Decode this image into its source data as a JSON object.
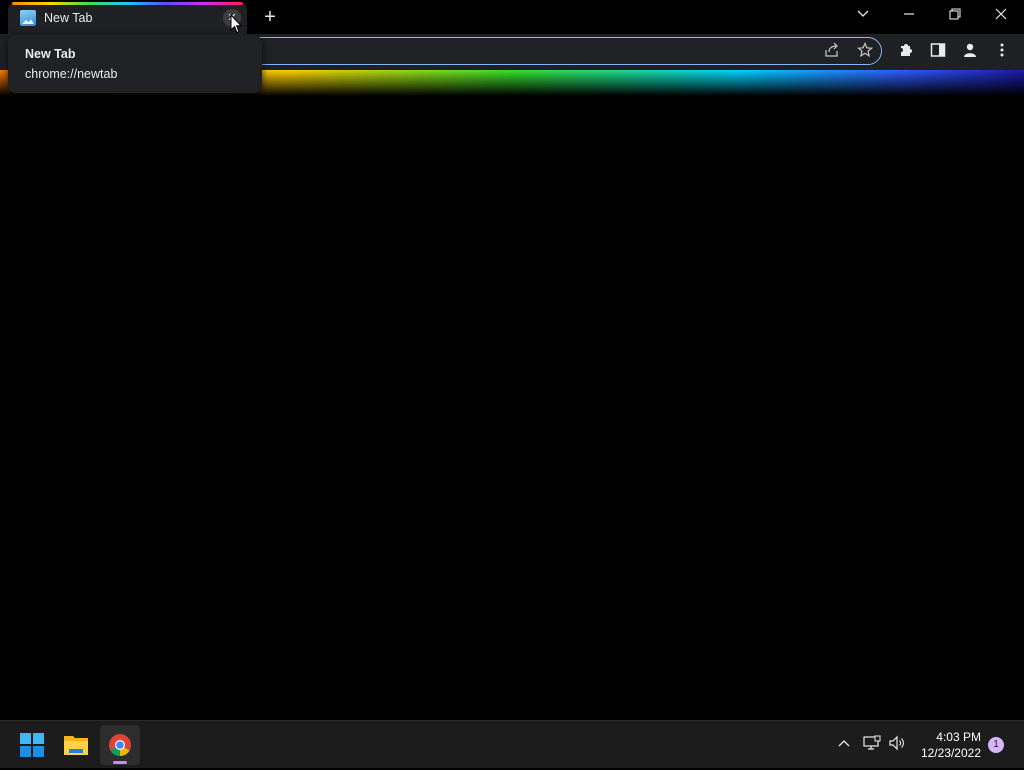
{
  "tab": {
    "title": "New Tab",
    "close_glyph": "✕",
    "favicon": "landscape-favicon-icon"
  },
  "new_tab": {
    "glyph": "+"
  },
  "window_controls": {
    "tab_search": "⌵",
    "minimize": "—",
    "restore": "❐",
    "close": "✕"
  },
  "omnibox": {
    "value": "",
    "share_icon": "share-icon",
    "bookmark_icon": "star-icon"
  },
  "toolbar_icons": [
    "extensions-icon",
    "side-panel-icon",
    "profile-icon",
    "menu-icon"
  ],
  "hovercard": {
    "title": "New Tab",
    "url": "chrome://newtab"
  },
  "taskbar": {
    "apps": [
      "windows-start-icon",
      "file-explorer-icon",
      "chrome-icon"
    ],
    "tray": [
      "chevron-up-icon",
      "network-icon",
      "volume-icon"
    ],
    "time": "4:03 PM",
    "date": "12/23/2022",
    "notification_count": "1"
  },
  "colors": {
    "omnibox_focus": "#8ab4f8",
    "active_app_indicator": "#c58af9",
    "notification": "#d8b4f8"
  }
}
